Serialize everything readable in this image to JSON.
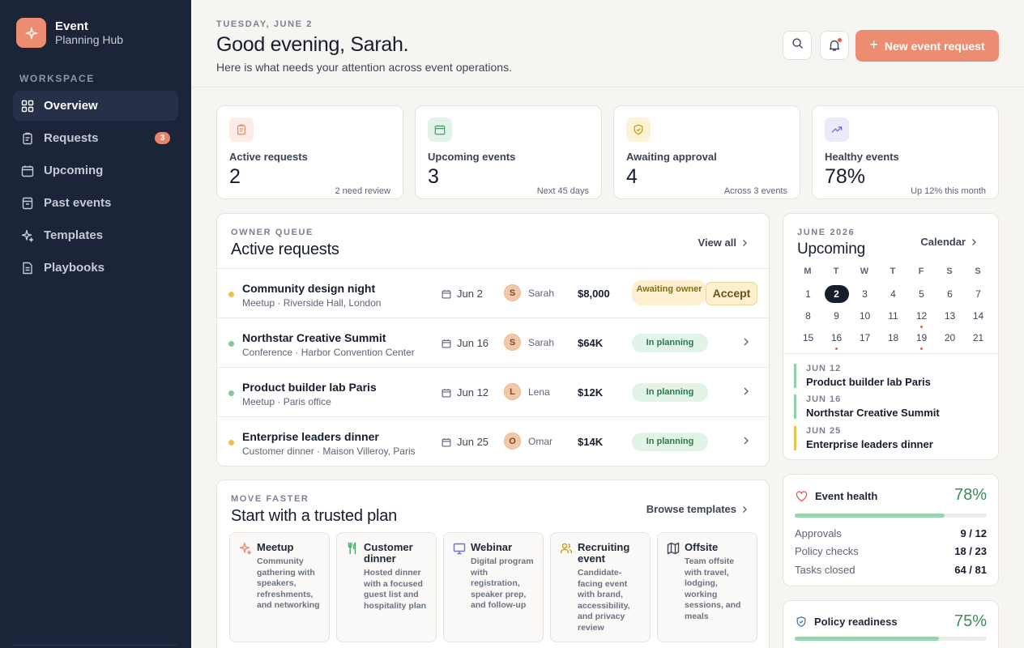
{
  "brand": {
    "name": "Event",
    "sub": "Planning Hub"
  },
  "sidebar": {
    "section_label": "WORKSPACE",
    "items": [
      {
        "label": "Overview",
        "icon": "grid-icon",
        "active": true
      },
      {
        "label": "Requests",
        "icon": "clipboard-icon",
        "badge": "3"
      },
      {
        "label": "Upcoming",
        "icon": "calendar-icon"
      },
      {
        "label": "Past events",
        "icon": "archive-icon"
      },
      {
        "label": "Templates",
        "icon": "sparkle-icon"
      },
      {
        "label": "Playbooks",
        "icon": "document-icon"
      }
    ]
  },
  "header": {
    "date": "TUESDAY, JUNE 2",
    "greeting": "Good evening, Sarah.",
    "subtitle": "Here is what needs your attention across event operations.",
    "new_button": "New event request"
  },
  "stats": [
    {
      "label": "Active requests",
      "value": "2",
      "note": "2 need review",
      "icon": "clipboard-icon",
      "color": "#ec8d72"
    },
    {
      "label": "Upcoming events",
      "value": "3",
      "note": "Next 45 days",
      "icon": "calendar-icon",
      "color": "#4aa870"
    },
    {
      "label": "Awaiting approval",
      "value": "4",
      "note": "Across 3 events",
      "icon": "shield-icon",
      "color": "#c99a1f"
    },
    {
      "label": "Healthy events",
      "value": "78%",
      "note": "Up 12% this month",
      "icon": "trend-up-icon",
      "color": "#6b74d6"
    }
  ],
  "requests": {
    "eyebrow": "OWNER QUEUE",
    "title": "Active requests",
    "view_all": "View all",
    "rows": [
      {
        "name": "Community design night",
        "meta": "Meetup · Riverside Hall, London",
        "date": "Jun 2",
        "owner_initial": "S",
        "owner": "Sarah",
        "budget": "$8,000",
        "status": "Awaiting owner",
        "action": "Accept",
        "dot": "#e8c14f"
      },
      {
        "name": "Northstar Creative Summit",
        "meta": "Conference · Harbor Convention Center",
        "date": "Jun 16",
        "owner_initial": "S",
        "owner": "Sarah",
        "budget": "$64K",
        "status": "In planning",
        "dot": "#7cc99a"
      },
      {
        "name": "Product builder lab Paris",
        "meta": "Meetup · Paris office",
        "date": "Jun 12",
        "owner_initial": "L",
        "owner": "Lena",
        "budget": "$12K",
        "status": "In planning",
        "dot": "#7cc99a"
      },
      {
        "name": "Enterprise leaders dinner",
        "meta": "Customer dinner · Maison Villeroy, Paris",
        "date": "Jun 25",
        "owner_initial": "O",
        "owner": "Omar",
        "budget": "$14K",
        "status": "In planning",
        "dot": "#e8c14f"
      }
    ]
  },
  "templates": {
    "eyebrow": "MOVE FASTER",
    "title": "Start with a trusted plan",
    "browse": "Browse templates",
    "items": [
      {
        "title": "Meetup",
        "desc": "Community gathering with speakers, refreshments, and networking",
        "icon": "sparkle-icon",
        "color": "#ec8d72"
      },
      {
        "title": "Customer dinner",
        "desc": "Hosted dinner with a focused guest list and hospitality plan",
        "icon": "utensils-icon",
        "color": "#4aa870"
      },
      {
        "title": "Webinar",
        "desc": "Digital program with registration, speaker prep, and follow-up",
        "icon": "monitor-icon",
        "color": "#6b74d6"
      },
      {
        "title": "Recruiting event",
        "desc": "Candidate-facing event with brand, accessibility, and privacy review",
        "icon": "users-icon",
        "color": "#c99a1f"
      },
      {
        "title": "Offsite",
        "desc": "Team offsite with travel, lodging, working sessions, and meals",
        "icon": "map-icon",
        "color": "#3e4556"
      }
    ]
  },
  "calendar": {
    "eyebrow": "JUNE 2026",
    "title": "Upcoming",
    "link": "Calendar",
    "weekdays": [
      "M",
      "T",
      "W",
      "T",
      "F",
      "S",
      "S"
    ],
    "weeks": [
      [
        "1",
        "2",
        "3",
        "4",
        "5",
        "6",
        "7"
      ],
      [
        "8",
        "9",
        "10",
        "11",
        "12",
        "13",
        "14"
      ],
      [
        "15",
        "16",
        "17",
        "18",
        "19",
        "20",
        "21"
      ]
    ],
    "today": "2",
    "event_days": [
      "12",
      "16",
      "19"
    ],
    "events": [
      {
        "date": "JUN 12",
        "name": "Product builder lab Paris",
        "color": "#8fd0a8"
      },
      {
        "date": "JUN 16",
        "name": "Northstar Creative Summit",
        "color": "#8fd0a8"
      },
      {
        "date": "JUN 25",
        "name": "Enterprise leaders dinner",
        "color": "#e8c14f"
      }
    ]
  },
  "health": {
    "title": "Event health",
    "pct": "78%",
    "progress": 0.78,
    "rows": [
      {
        "label": "Approvals",
        "value": "9 / 12"
      },
      {
        "label": "Policy checks",
        "value": "18 / 23"
      },
      {
        "label": "Tasks closed",
        "value": "64 / 81"
      }
    ]
  },
  "policy": {
    "title": "Policy readiness",
    "pct": "75%",
    "progress": 0.75
  }
}
